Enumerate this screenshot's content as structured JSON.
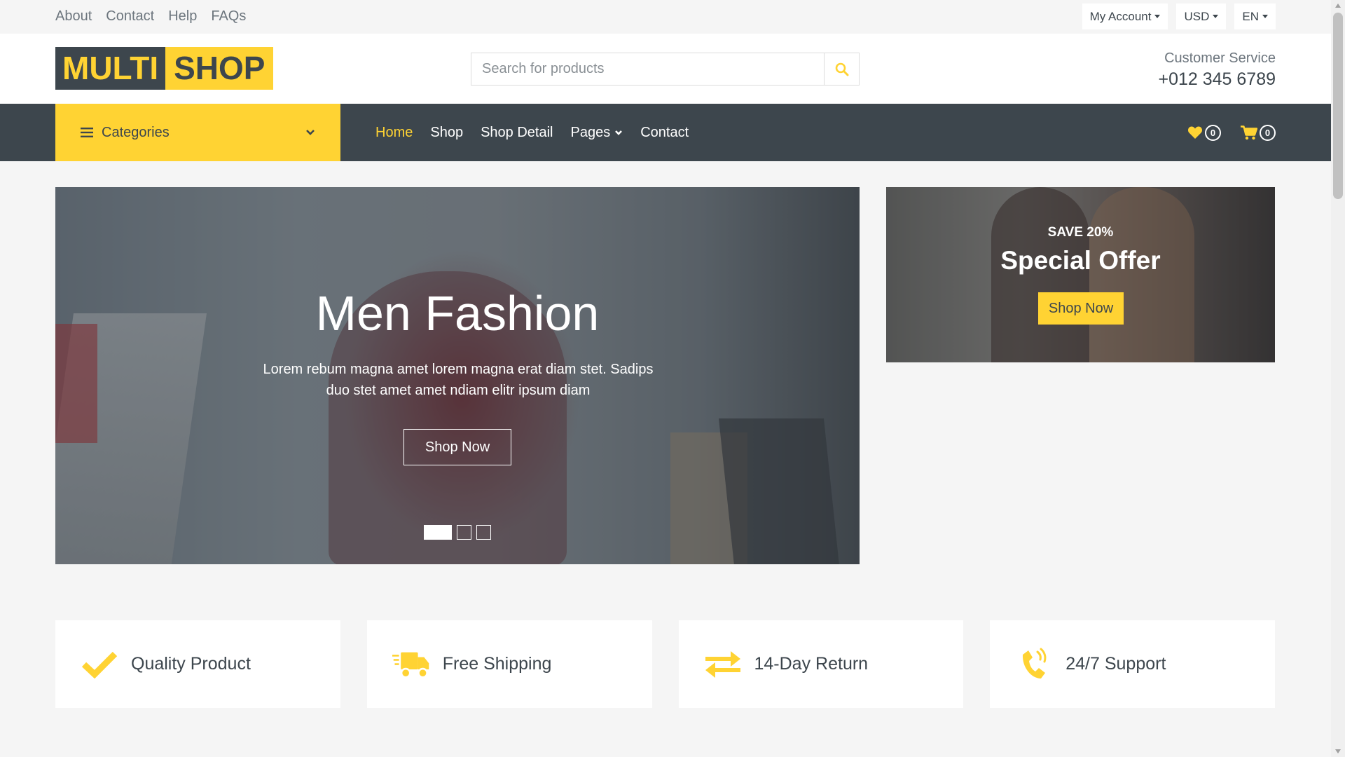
{
  "topbar": {
    "links": [
      "About",
      "Contact",
      "Help",
      "FAQs"
    ],
    "account_label": "My Account",
    "currency_label": "USD",
    "language_label": "EN"
  },
  "header": {
    "logo_part1": "MULTI",
    "logo_part2": "SHOP",
    "search_placeholder": "Search for products",
    "customer_service_label": "Customer Service",
    "phone": "+012 345 6789"
  },
  "navbar": {
    "categories_label": "Categories",
    "menu": [
      "Home",
      "Shop",
      "Shop Detail",
      "Pages",
      "Contact"
    ],
    "active_menu": "Home",
    "wishlist_count": "0",
    "cart_count": "0"
  },
  "hero": {
    "title": "Men Fashion",
    "text": "Lorem rebum magna amet lorem magna erat diam stet. Sadips duo stet amet amet ndiam elitr ipsum diam",
    "button": "Shop Now",
    "slides": 3,
    "active_slide": 1
  },
  "offer": {
    "save": "SAVE 20%",
    "title": "Special Offer",
    "button": "Shop Now"
  },
  "features": [
    {
      "icon": "check-icon",
      "label": "Quality Product"
    },
    {
      "icon": "shipping-fast-icon",
      "label": "Free Shipping"
    },
    {
      "icon": "exchange-arrows-icon",
      "label": "14-Day Return"
    },
    {
      "icon": "phone-volume-icon",
      "label": "24/7 Support"
    }
  ],
  "colors": {
    "primary": "#ffd333",
    "dark": "#3d464d",
    "light": "#f5f5f5",
    "muted": "#6c757d"
  }
}
